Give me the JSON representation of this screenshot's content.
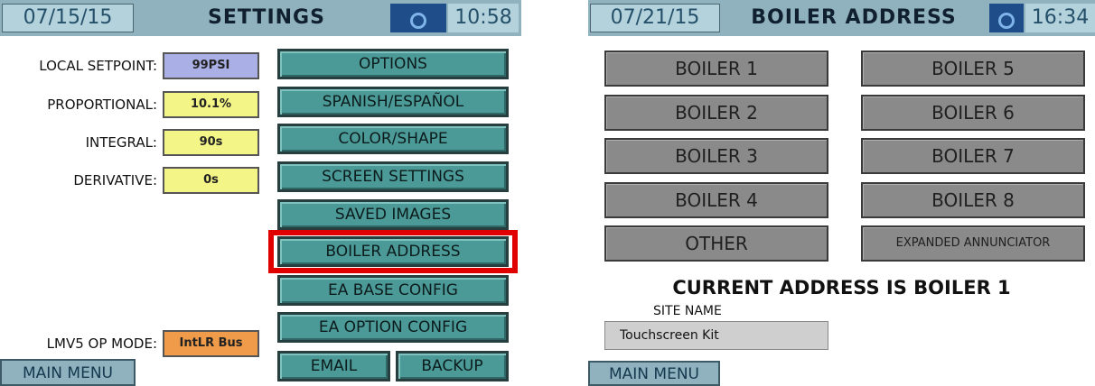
{
  "settings": {
    "date": "07/15/15",
    "title": "SETTINGS",
    "time": "10:58",
    "camera_icon": "camera-icon",
    "fields": [
      {
        "label": "LOCAL SETPOINT:",
        "value": "99PSI",
        "color": "#aab0e6"
      },
      {
        "label": "PROPORTIONAL:",
        "value": "10.1%",
        "color": "#f3f586"
      },
      {
        "label": "INTEGRAL:",
        "value": "90s",
        "color": "#f3f586"
      },
      {
        "label": "DERIVATIVE:",
        "value": "0s",
        "color": "#f3f586"
      }
    ],
    "lmv5": {
      "label": "LMV5 OP MODE:",
      "value": "IntLR Bus",
      "color": "#f09b4a"
    },
    "menu_buttons": [
      "OPTIONS",
      "SPANISH/ESPAÑOL",
      "COLOR/SHAPE",
      "SCREEN SETTINGS",
      "SAVED IMAGES",
      "BOILER ADDRESS",
      "EA BASE CONFIG",
      "EA OPTION CONFIG"
    ],
    "email_label": "EMAIL",
    "backup_label": "BACKUP",
    "main_menu_label": "MAIN MENU",
    "highlight_color": "#e00000"
  },
  "boiler_address": {
    "date": "07/21/15",
    "title": "BOILER ADDRESS",
    "time": "16:34",
    "camera_icon": "camera-icon",
    "boilers_left": [
      "BOILER 1",
      "BOILER 2",
      "BOILER 3",
      "BOILER 4"
    ],
    "boilers_right": [
      "BOILER 5",
      "BOILER 6",
      "BOILER 7",
      "BOILER 8"
    ],
    "other_label": "OTHER",
    "expanded_label": "EXPANDED ANNUNCIATOR",
    "current_address": "CURRENT ADDRESS IS BOILER 1",
    "site_name_label": "SITE NAME",
    "site_name_value": "Touchscreen Kit",
    "main_menu_label": "MAIN MENU"
  }
}
